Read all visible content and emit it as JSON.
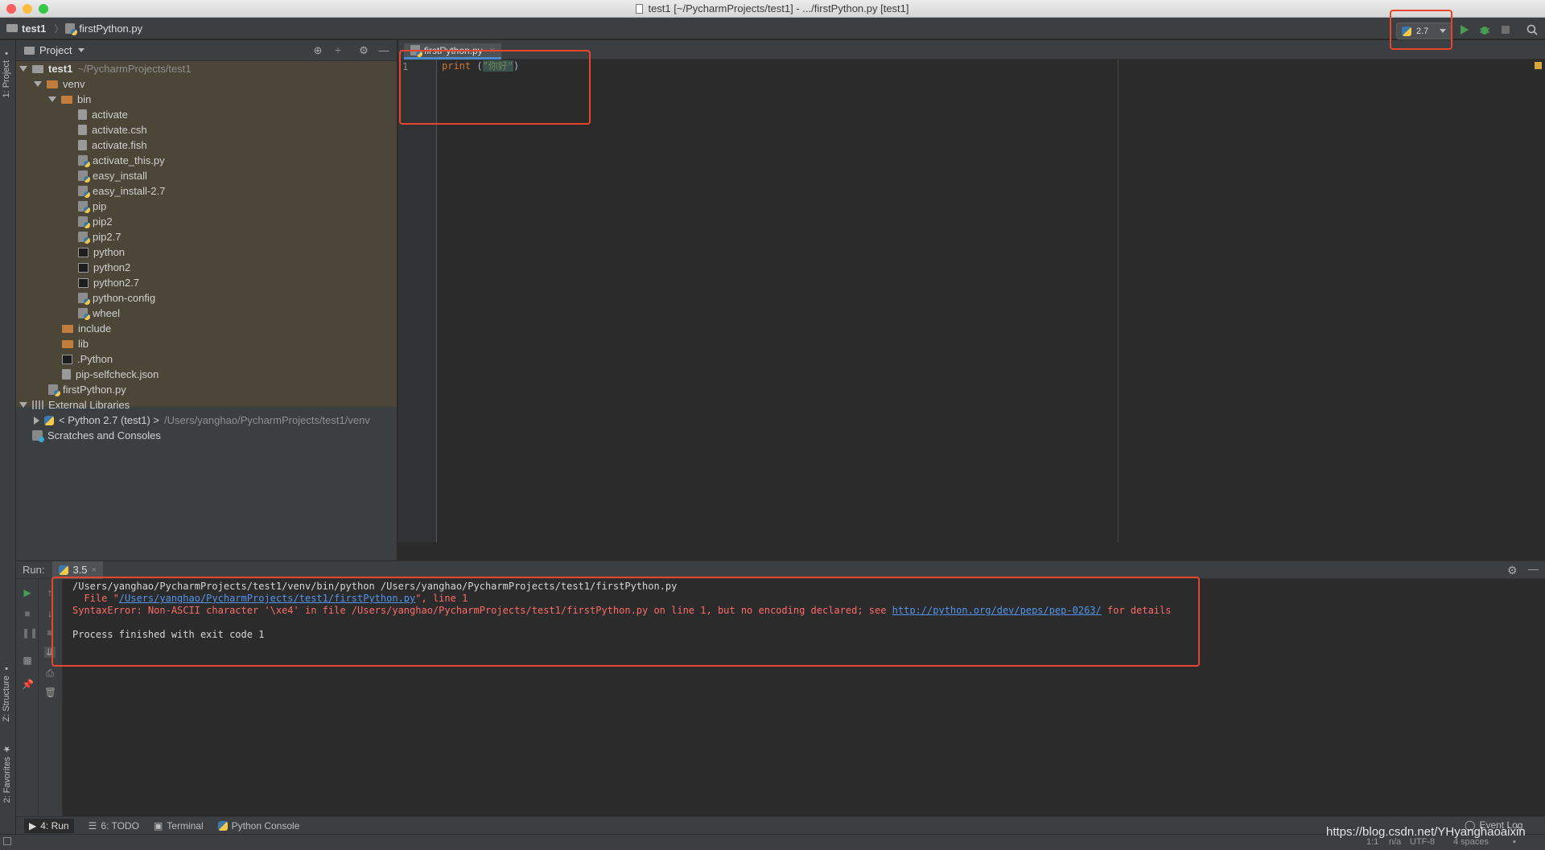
{
  "window": {
    "title": "test1 [~/PycharmProjects/test1] - .../firstPython.py [test1]",
    "traffic_colors": [
      "#fc605c",
      "#fdbc40",
      "#34c84a"
    ]
  },
  "navbar": {
    "crumbs": [
      "test1",
      "firstPython.py"
    ],
    "interpreter": "2.7"
  },
  "left_stripe": {
    "project_tab": "1: Project",
    "structure_tab": "Z: Structure",
    "favorites_tab": "2: Favorites"
  },
  "project_panel": {
    "title": "Project",
    "root_name": "test1",
    "root_path": "~/PycharmProjects/test1",
    "venv": "venv",
    "bin": "bin",
    "bin_files": [
      "activate",
      "activate.csh",
      "activate.fish",
      "activate_this.py",
      "easy_install",
      "easy_install-2.7",
      "pip",
      "pip2",
      "pip2.7",
      "python",
      "python2",
      "python2.7",
      "python-config",
      "wheel"
    ],
    "include": "include",
    "lib": "lib",
    "dotpython": ".Python",
    "selfcheck": "pip-selfcheck.json",
    "firstpython": "firstPython.py",
    "external_libraries": "External Libraries",
    "python_sdk": "< Python 2.7 (test1) >",
    "python_sdk_path": "/Users/yanghao/PycharmProjects/test1/venv",
    "scratches": "Scratches and Consoles"
  },
  "editor": {
    "tab_label": "firstPython.py",
    "line_number": "1",
    "code_keyword": "print",
    "code_open": " (",
    "code_string": "\"你好\"",
    "code_close": ")"
  },
  "run": {
    "label": "Run:",
    "tab": "3.5",
    "line1": "/Users/yanghao/PycharmProjects/test1/venv/bin/python /Users/yanghao/PycharmProjects/test1/firstPython.py",
    "file_prefix": "  File \"",
    "file_link": "/Users/yanghao/PycharmProjects/test1/firstPython.py",
    "file_suffix": "\", line 1",
    "error_prefix": "SyntaxError: Non-ASCII character '\\xe4' in file /Users/yanghao/PycharmProjects/test1/firstPython.py on line 1, but no encoding declared; see ",
    "error_link": "http://python.org/dev/peps/pep-0263/",
    "error_suffix": " for details",
    "finished": "Process finished with exit code 1"
  },
  "bottom_tools": {
    "run": "4: Run",
    "todo": "6: TODO",
    "terminal": "Terminal",
    "python_console": "Python Console",
    "event_log": "Event Log"
  },
  "status": {
    "position": "1:1",
    "line_sep": "n/a",
    "encoding": "UTF-8",
    "indent": "4 spaces"
  },
  "watermark": "https://blog.csdn.net/YHyanghaoaixin",
  "colors": {
    "annotation_red": "#e8452c",
    "error_text": "#ff6b68",
    "link": "#5394ec"
  }
}
